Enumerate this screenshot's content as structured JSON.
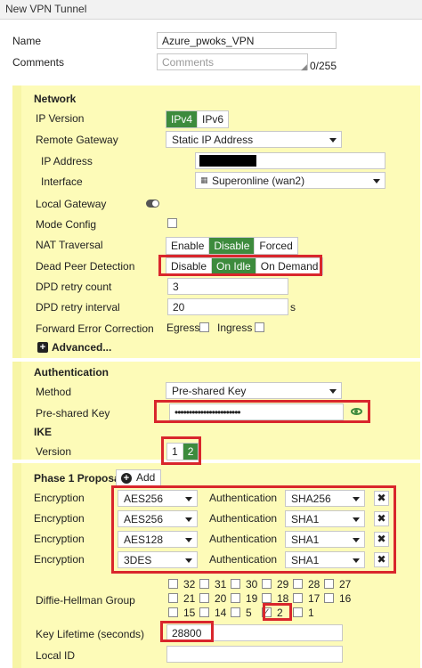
{
  "window": {
    "title": "New VPN Tunnel"
  },
  "general": {
    "name_label": "Name",
    "name_value": "Azure_pwoks_VPN",
    "comments_label": "Comments",
    "comments_placeholder": "Comments",
    "comments_counter": "0/255"
  },
  "network": {
    "heading": "Network",
    "ip_version": {
      "label": "IP Version",
      "options": [
        "IPv4",
        "IPv6"
      ],
      "selected": "IPv4"
    },
    "remote_gateway": {
      "label": "Remote Gateway",
      "value": "Static IP Address"
    },
    "ip_address": {
      "label": "IP Address"
    },
    "interface": {
      "label": "Interface",
      "value": "Superonline (wan2)"
    },
    "local_gateway": {
      "label": "Local Gateway"
    },
    "mode_config": {
      "label": "Mode Config"
    },
    "nat_traversal": {
      "label": "NAT Traversal",
      "options": [
        "Enable",
        "Disable",
        "Forced"
      ],
      "selected": "Disable"
    },
    "dpd": {
      "label": "Dead Peer Detection",
      "options": [
        "Disable",
        "On Idle",
        "On Demand"
      ],
      "selected": "On Idle"
    },
    "dpd_retry_count": {
      "label": "DPD retry count",
      "value": "3"
    },
    "dpd_retry_interval": {
      "label": "DPD retry interval",
      "value": "20",
      "unit": "s"
    },
    "fec": {
      "label": "Forward Error Correction",
      "egress": "Egress",
      "ingress": "Ingress"
    },
    "advanced_label": "Advanced..."
  },
  "authentication": {
    "heading": "Authentication",
    "method": {
      "label": "Method",
      "value": "Pre-shared Key"
    },
    "psk": {
      "label": "Pre-shared Key",
      "value": "•••••••••••••••••••••••"
    }
  },
  "ike": {
    "heading": "IKE",
    "version": {
      "label": "Version",
      "options": [
        "1",
        "2"
      ],
      "selected": "2"
    }
  },
  "phase1": {
    "heading": "Phase 1 Proposal",
    "add_label": "Add",
    "proposals": [
      {
        "enc_label": "Encryption",
        "enc": "AES256",
        "auth_label": "Authentication",
        "auth": "SHA256"
      },
      {
        "enc_label": "Encryption",
        "enc": "AES256",
        "auth_label": "Authentication",
        "auth": "SHA1"
      },
      {
        "enc_label": "Encryption",
        "enc": "AES128",
        "auth_label": "Authentication",
        "auth": "SHA1"
      },
      {
        "enc_label": "Encryption",
        "enc": "3DES",
        "auth_label": "Authentication",
        "auth": "SHA1"
      }
    ],
    "dh": {
      "label": "Diffie-Hellman Group",
      "groups": [
        "32",
        "31",
        "30",
        "29",
        "28",
        "27",
        "21",
        "20",
        "19",
        "18",
        "17",
        "16",
        "15",
        "14",
        "5",
        "2",
        "1"
      ],
      "checked": [
        "2"
      ]
    },
    "key_lifetime": {
      "label": "Key Lifetime (seconds)",
      "value": "28800"
    },
    "local_id": {
      "label": "Local ID"
    }
  },
  "colors": {
    "panel": "#fdfbb8",
    "active": "#3d8b3d",
    "highlight": "#d9262c"
  }
}
